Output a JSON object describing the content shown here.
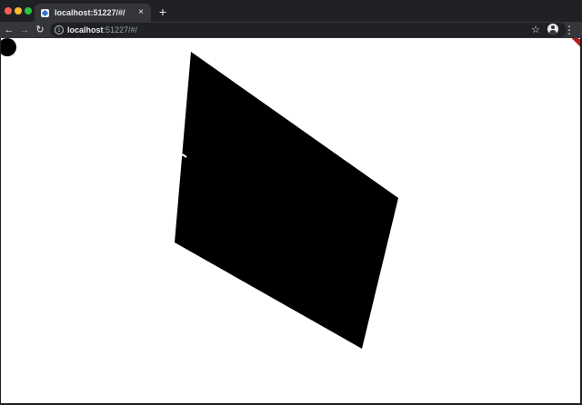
{
  "browser": {
    "tab": {
      "title": "localhost:51227/#/",
      "close_icon": "×"
    },
    "new_tab_icon": "+",
    "toolbar": {
      "back_icon": "←",
      "forward_icon": "→",
      "reload_icon": "↻",
      "star_icon": "☆",
      "menu_icon": "⋮"
    },
    "omnibox": {
      "info_icon": "i",
      "url_host": "localhost",
      "url_rest": ":51227/#/"
    }
  },
  "app": {
    "debug_banner": "DEBUG",
    "shape_color": "#000000"
  }
}
